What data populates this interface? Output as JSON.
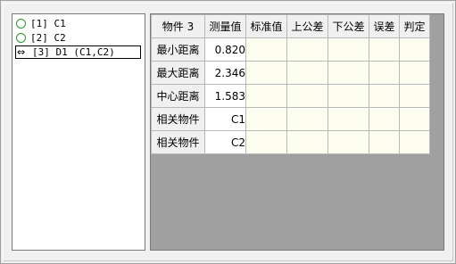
{
  "tree": {
    "items": [
      {
        "icon": "circle-icon",
        "label": "[1] C1"
      },
      {
        "icon": "circle-icon",
        "label": "[2] C2"
      },
      {
        "icon": "distance-icon",
        "label": "[3] D1 (C1,C2)"
      }
    ],
    "distance_glyph": "⇔"
  },
  "grid": {
    "corner_label": "物件 3",
    "columns": [
      "测量值",
      "标准值",
      "上公差",
      "下公差",
      "误差",
      "判定"
    ],
    "rows": [
      {
        "label": "最小距离",
        "measured": "0.820"
      },
      {
        "label": "最大距离",
        "measured": "2.346"
      },
      {
        "label": "中心距离",
        "measured": "1.583"
      },
      {
        "label": "相关物件",
        "measured": "C1"
      },
      {
        "label": "相关物件",
        "measured": "C2"
      }
    ]
  },
  "colors": {
    "grid_background": "#a0a0a0",
    "cell_background": "#fefef0",
    "circle_icon": "#2a9a2a"
  }
}
